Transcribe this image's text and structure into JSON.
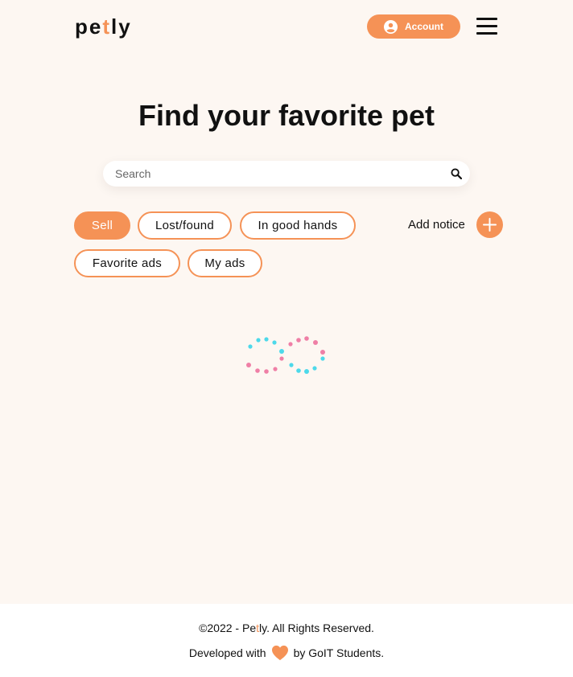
{
  "header": {
    "logo_part1": "pe",
    "logo_accent": "t",
    "logo_part2": "ly",
    "account_label": "Account",
    "icons": {
      "account": "user-circle-icon",
      "menu": "hamburger-menu-icon"
    }
  },
  "main": {
    "title": "Find your favorite pet",
    "search": {
      "placeholder": "Search",
      "value": "",
      "icon": "search-icon"
    },
    "filters": [
      {
        "label": "Sell",
        "active": true
      },
      {
        "label": "Lost/found",
        "active": false
      },
      {
        "label": "In good hands",
        "active": false
      },
      {
        "label": "Favorite ads",
        "active": false
      },
      {
        "label": "My ads",
        "active": false
      }
    ],
    "add_notice": {
      "label": "Add notice",
      "icon": "plus-icon"
    },
    "loader_icon": "infinity-spinner-icon"
  },
  "footer": {
    "copy_prefix": "©2022 - Pe",
    "copy_accent": "t",
    "copy_suffix": "ly. All Rights Reserved.",
    "dev_prefix": "Developed with",
    "dev_suffix": "by GoIT Students.",
    "heart_icon": "heart-icon"
  },
  "colors": {
    "accent": "#F59256",
    "background": "#FDF7F2",
    "loader_blue": "#4DD9EA",
    "loader_pink": "#EF7FA6"
  }
}
